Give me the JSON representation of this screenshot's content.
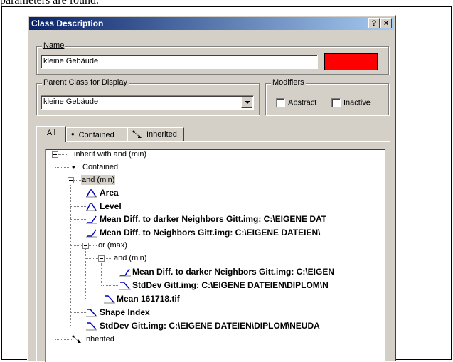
{
  "page": {
    "top_text": "parameters are found."
  },
  "window": {
    "title": "Class Description",
    "help_label": "?",
    "close_label": "×"
  },
  "name_group": {
    "label": "Name",
    "value": "kleine Gebäude",
    "color": "#ff0000"
  },
  "parent_group": {
    "label": "Parent Class for Display",
    "value": "kleine Gebäude"
  },
  "modifiers_group": {
    "label": "Modifiers",
    "abstract_label": "Abstract",
    "inactive_label": "Inactive"
  },
  "tabs": [
    {
      "label": "All"
    },
    {
      "label": "Contained"
    },
    {
      "label": "Inherited"
    }
  ],
  "tree": {
    "n0": "inherit with and (min)",
    "n1": "Contained",
    "n2": "and (min)",
    "n3": "Area",
    "n4": "Level",
    "n5": "Mean Diff. to darker Neighbors Gitt.img:  C:\\EIGENE DAT",
    "n6": "Mean Diff. to Neighbors Gitt.img:  C:\\EIGENE DATEIEN\\",
    "n7": "or (max)",
    "n8": "and (min)",
    "n9": "Mean Diff. to darker Neighbors Gitt.img:  C:\\EIGEN",
    "n10": "StdDev Gitt.img:  C:\\EIGENE DATEIEN\\DIPLOM\\N",
    "n11": "Mean 161718.tif",
    "n12": "Shape Index",
    "n13": "StdDev Gitt.img:  C:\\EIGENE DATEIEN\\DIPLOM\\NEUDA",
    "n14": "Inherited"
  }
}
